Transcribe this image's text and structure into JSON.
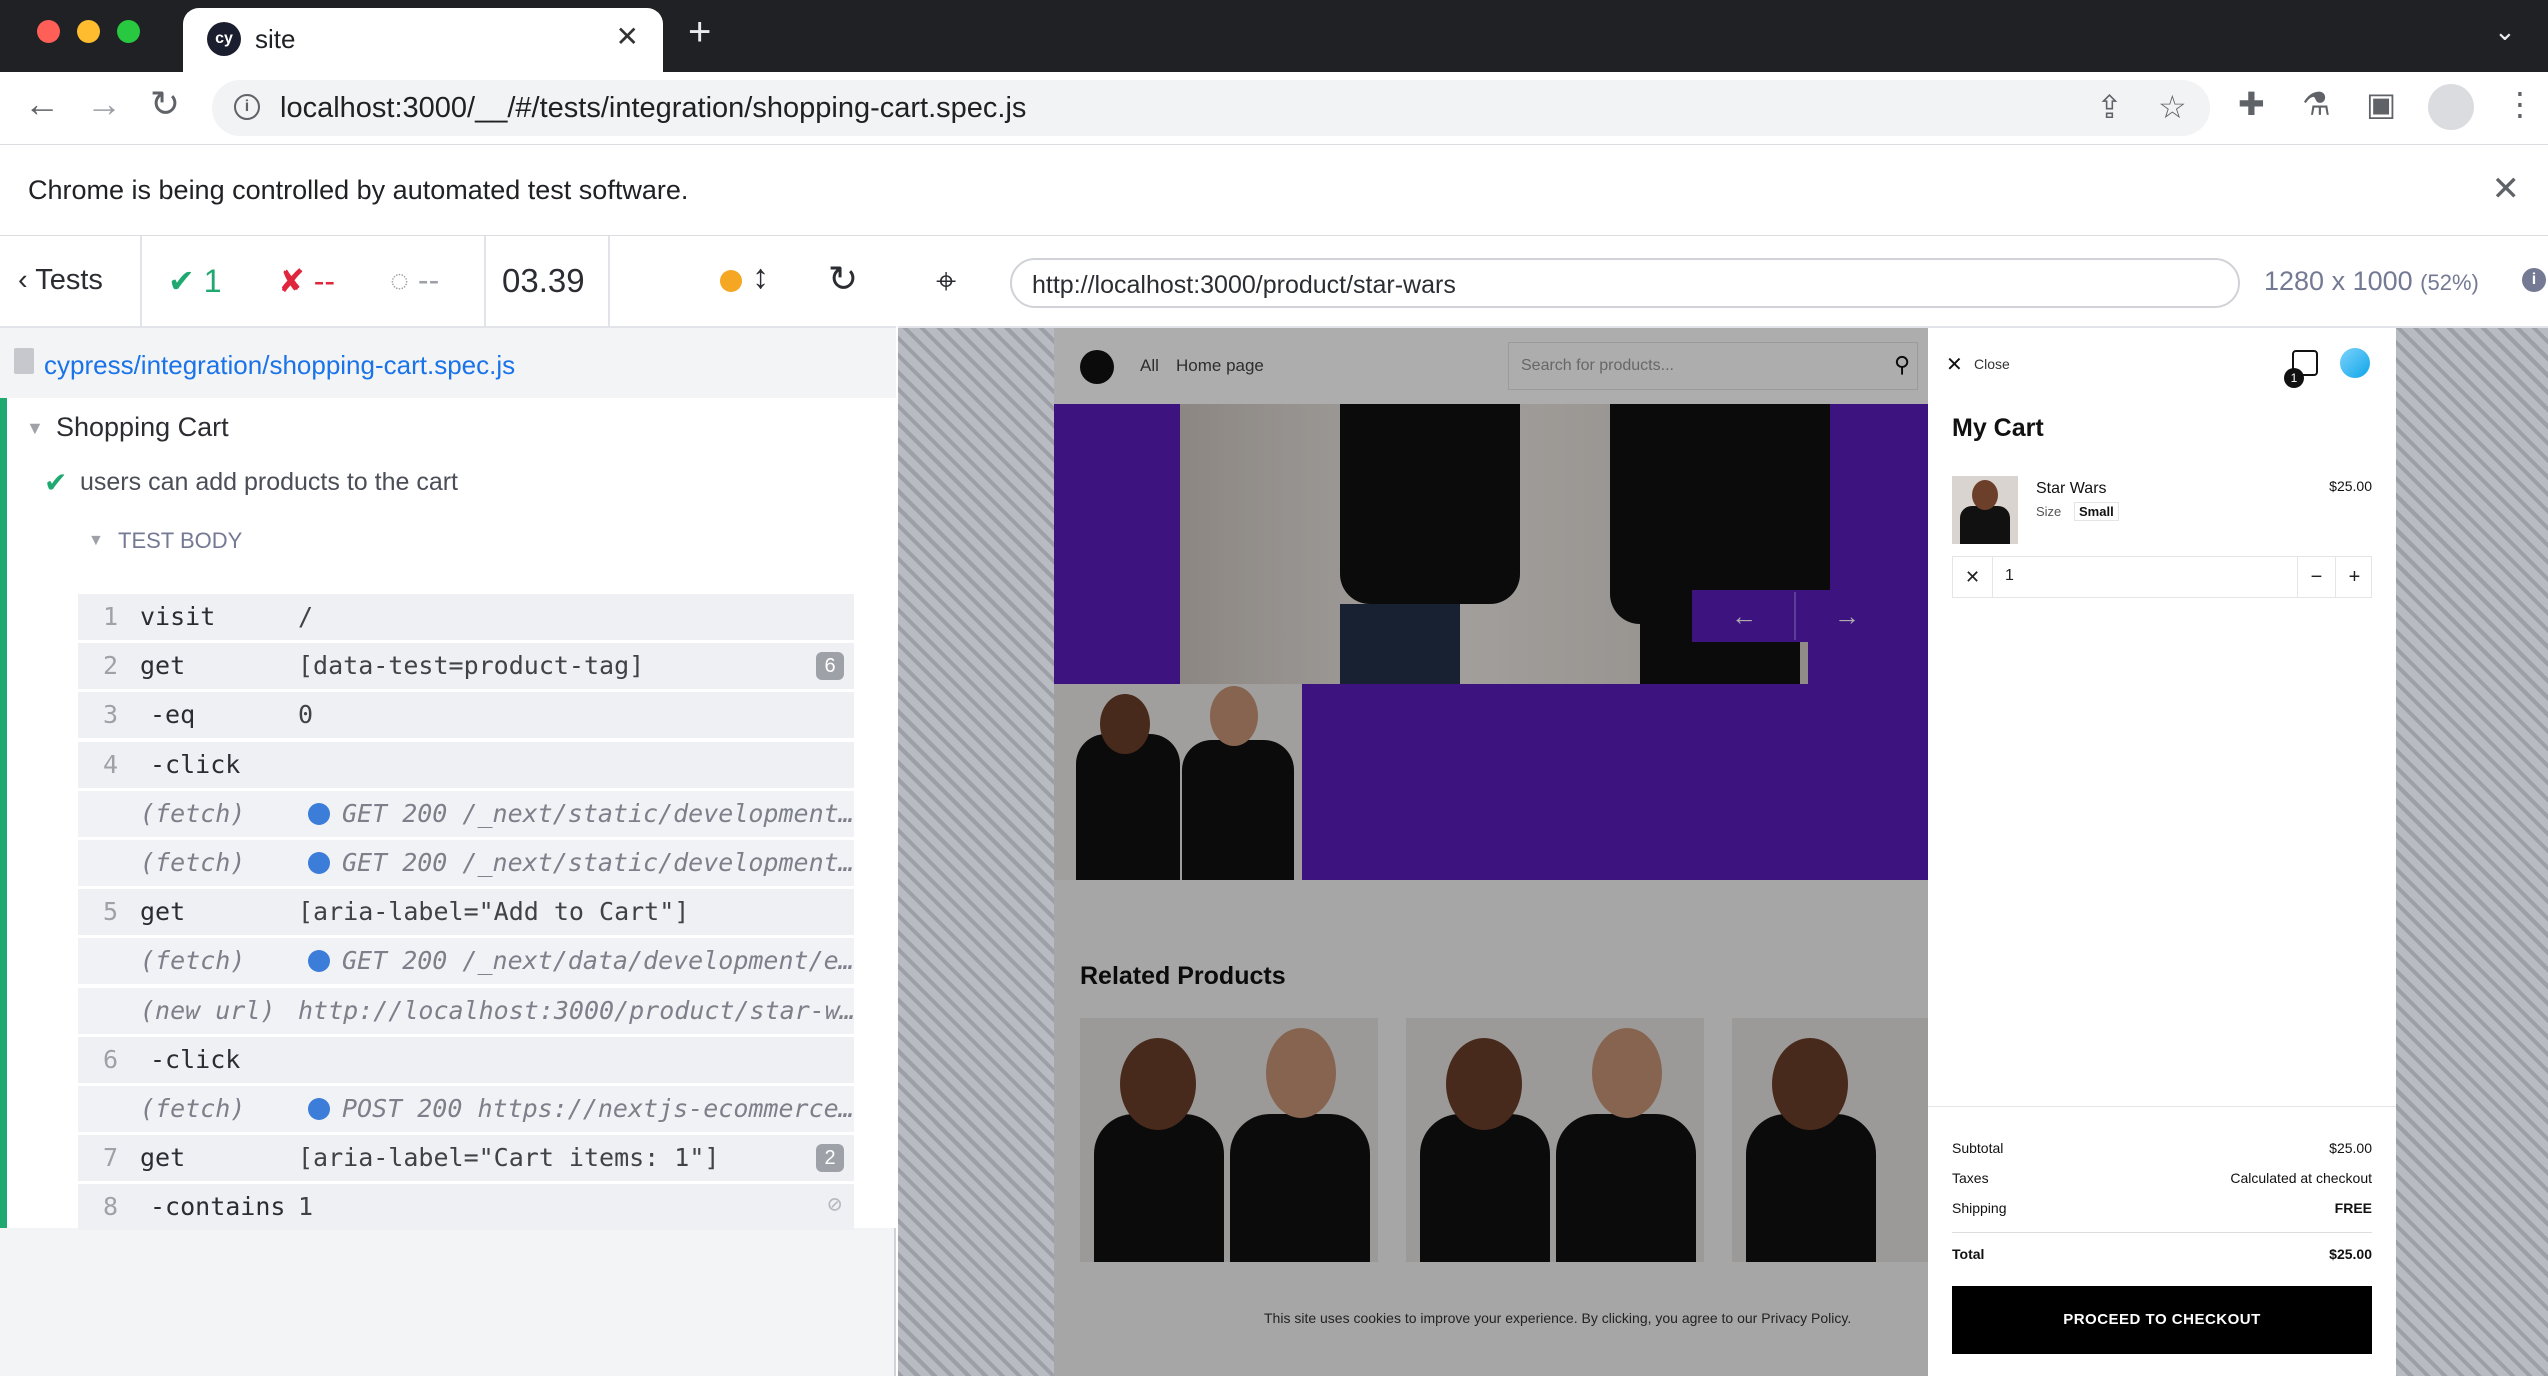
{
  "browser": {
    "tab_title": "site",
    "tab_favicon": "cy",
    "url": "localhost:3000/__/#/tests/integration/shopping-cart.spec.js",
    "infobar_text": "Chrome is being controlled by automated test software."
  },
  "reporter": {
    "tests_label": "Tests",
    "passed_count": "1",
    "failed_count": "--",
    "pending_count": "--",
    "duration": "03.39",
    "spec_file": "cypress/integration/shopping-cart.spec.js",
    "suite_title": "Shopping Cart",
    "test_title": "users can add products to the cart",
    "test_body_label": "TEST BODY",
    "commands": [
      {
        "num": "1",
        "name": "visit",
        "message": "/",
        "badge": "",
        "type": "cmd"
      },
      {
        "num": "2",
        "name": "get",
        "message": "[data-test=product-tag]",
        "badge": "6",
        "type": "cmd"
      },
      {
        "num": "3",
        "name": "-eq",
        "message": "0",
        "badge": "",
        "type": "child"
      },
      {
        "num": "4",
        "name": "-click",
        "message": "",
        "badge": "",
        "type": "child"
      },
      {
        "num": "",
        "name": "(fetch)",
        "message": "GET 200 /_next/static/development…",
        "badge": "",
        "type": "fetch"
      },
      {
        "num": "",
        "name": "(fetch)",
        "message": "GET 200 /_next/static/development…",
        "badge": "",
        "type": "fetch"
      },
      {
        "num": "5",
        "name": "get",
        "message": "[aria-label=\"Add to Cart\"]",
        "badge": "",
        "type": "cmd"
      },
      {
        "num": "",
        "name": "(fetch)",
        "message": "GET 200 /_next/data/development/e…",
        "badge": "",
        "type": "fetch"
      },
      {
        "num": "",
        "name": "(new url)",
        "message": "http://localhost:3000/product/star-w…",
        "badge": "",
        "type": "newurl"
      },
      {
        "num": "6",
        "name": "-click",
        "message": "",
        "badge": "",
        "type": "child"
      },
      {
        "num": "",
        "name": "(fetch)",
        "message": "POST 200 https://nextjs-ecommerce…",
        "badge": "",
        "type": "fetch"
      },
      {
        "num": "7",
        "name": "get",
        "message": "[aria-label=\"Cart items: 1\"]",
        "badge": "2",
        "type": "cmd"
      },
      {
        "num": "8",
        "name": "-contains",
        "message": "1",
        "badge": "",
        "type": "child"
      }
    ]
  },
  "aut": {
    "url": "http://localhost:3000/product/star-wars",
    "viewport_size": "1280 x 1000",
    "viewport_scale": "(52%)"
  },
  "site": {
    "nav_all": "All",
    "nav_home": "Home page",
    "search_placeholder": "Search for products...",
    "related_title": "Related Products",
    "cookie_text": "This site uses cookies to improve your experience. By clicking, you agree to our Privacy Policy.",
    "cart": {
      "close_label": "Close",
      "bag_count": "1",
      "title": "My Cart",
      "item_name": "Star Wars",
      "item_size_label": "Size",
      "item_size": "Small",
      "item_price": "$25.00",
      "quantity": "1",
      "subtotal_label": "Subtotal",
      "subtotal": "$25.00",
      "taxes_label": "Taxes",
      "taxes": "Calculated at checkout",
      "shipping_label": "Shipping",
      "shipping": "FREE",
      "total_label": "Total",
      "total": "$25.00",
      "checkout_label": "PROCEED TO CHECKOUT"
    }
  },
  "colors": {
    "pass": "#1fa971",
    "fail": "#e0263d",
    "link": "#1a73e8",
    "purple": "#5a1dbd",
    "running_dot": "#f5a623"
  }
}
